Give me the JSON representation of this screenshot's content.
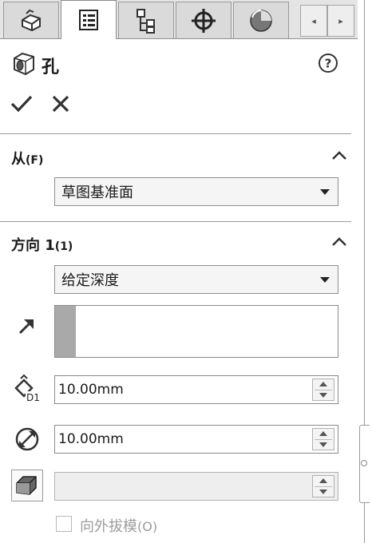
{
  "tabs": [
    {
      "icon": "feature-manager-icon"
    },
    {
      "icon": "property-manager-icon",
      "active": true
    },
    {
      "icon": "configuration-manager-icon"
    },
    {
      "icon": "dimxpert-icon"
    },
    {
      "icon": "display-manager-icon"
    }
  ],
  "tab_scroll": {
    "left": "◂",
    "right": "▸"
  },
  "feature": {
    "title": "孔",
    "icon": "hole-feature-icon"
  },
  "from_section": {
    "title": "从",
    "suffix": "(F)",
    "dropdown_value": "草图基准面"
  },
  "direction_section": {
    "title": "方向 1",
    "suffix": "(1)",
    "end_condition": "给定深度"
  },
  "depth": {
    "value": "10.00mm"
  },
  "diameter": {
    "value": "10.00mm"
  },
  "draft": {
    "value": ""
  },
  "draft_outward": {
    "label": "向外拔模",
    "suffix": "(O)",
    "checked": false
  },
  "colors": {
    "accent_bar": "#a9a9a9",
    "divider": "#9a9a9a",
    "disabled_text": "#9d9d9d"
  }
}
